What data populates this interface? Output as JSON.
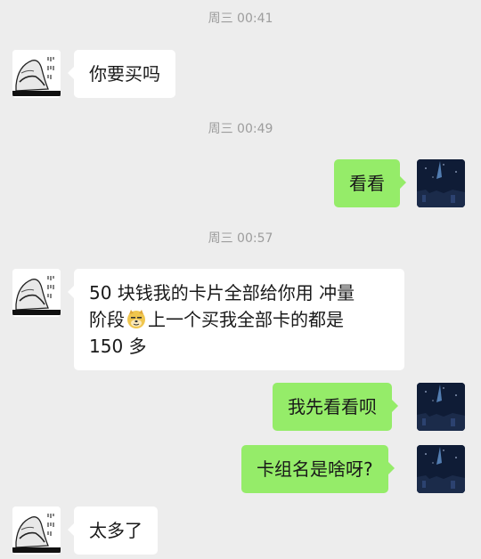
{
  "timestamps": [
    "周三 00:41",
    "周三 00:49",
    "周三 00:57"
  ],
  "messages": [
    {
      "side": "received",
      "text": "你要买吗"
    },
    {
      "side": "sent",
      "text": "看看"
    },
    {
      "side": "received",
      "lines": [
        "50 块钱我的卡片全部给你用 冲量",
        "阶段",
        "上一个买我全部卡的都是",
        "150 多"
      ],
      "emoji": "doge-emoji"
    },
    {
      "side": "sent",
      "text": "我先看看呗"
    },
    {
      "side": "sent",
      "text": "卡组名是啥呀?"
    },
    {
      "side": "received",
      "text": "太多了"
    }
  ],
  "avatars": {
    "contact": "calligraphy-sketch-avatar",
    "self": "night-sky-avatar"
  },
  "colors": {
    "background": "#ededed",
    "received_bubble": "#ffffff",
    "sent_bubble": "#95ec69",
    "timestamp_text": "#9d9d9d"
  }
}
